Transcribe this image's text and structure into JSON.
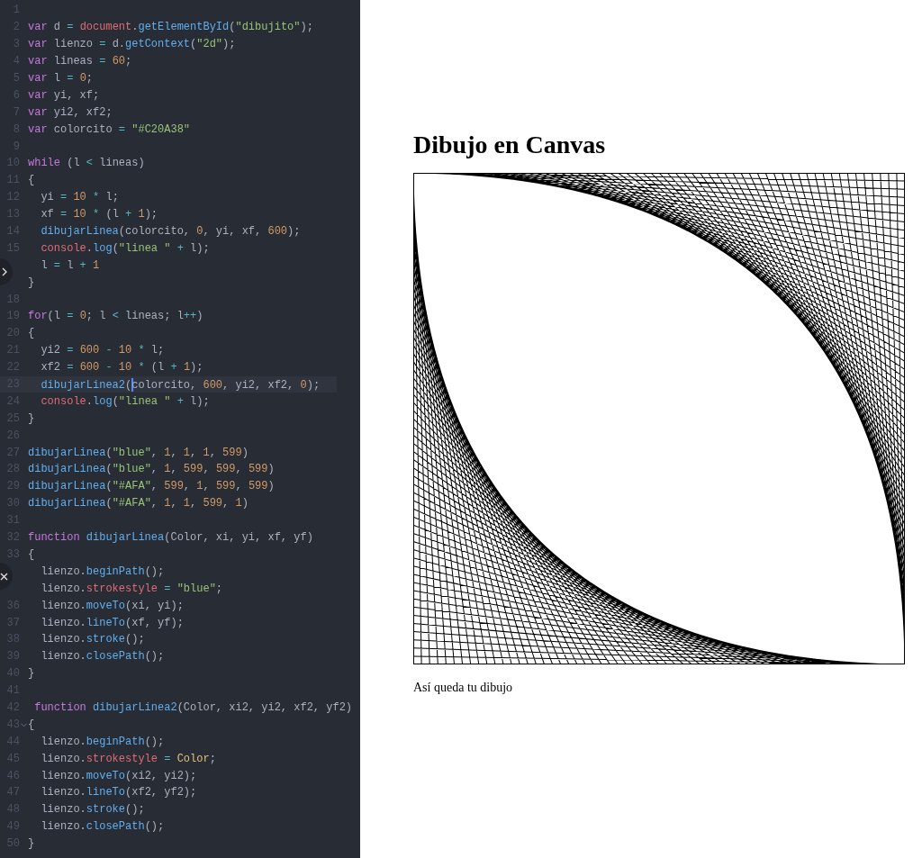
{
  "editor": {
    "lines": [
      {
        "number": "1",
        "active": false,
        "fold_marker": false
      },
      {
        "number": "2",
        "active": false,
        "fold_marker": false,
        "tokens": [
          {
            "kind": "kw",
            "text": "var"
          },
          {
            "kind": "plain",
            "text": " d"
          },
          {
            "kind": "op",
            "text": " = "
          },
          {
            "kind": "red",
            "text": "document"
          },
          {
            "kind": "plain",
            "text": "."
          },
          {
            "kind": "fn",
            "text": "getElementById"
          },
          {
            "kind": "plain",
            "text": "("
          },
          {
            "kind": "str",
            "text": "\"dibujito\""
          },
          {
            "kind": "plain",
            "text": ");"
          }
        ]
      },
      {
        "number": "3",
        "active": false,
        "fold_marker": false,
        "tokens": [
          {
            "kind": "kw",
            "text": "var"
          },
          {
            "kind": "plain",
            "text": " lienzo"
          },
          {
            "kind": "op",
            "text": " = "
          },
          {
            "kind": "plain",
            "text": "d."
          },
          {
            "kind": "fn",
            "text": "getContext"
          },
          {
            "kind": "plain",
            "text": "("
          },
          {
            "kind": "str",
            "text": "\"2d\""
          },
          {
            "kind": "plain",
            "text": ");"
          }
        ]
      },
      {
        "number": "4",
        "active": false,
        "fold_marker": false,
        "tokens": [
          {
            "kind": "kw",
            "text": "var"
          },
          {
            "kind": "plain",
            "text": " lineas"
          },
          {
            "kind": "op",
            "text": " = "
          },
          {
            "kind": "num",
            "text": "60"
          },
          {
            "kind": "plain",
            "text": ";"
          }
        ]
      },
      {
        "number": "5",
        "active": false,
        "fold_marker": false,
        "tokens": [
          {
            "kind": "kw",
            "text": "var"
          },
          {
            "kind": "plain",
            "text": " l"
          },
          {
            "kind": "op",
            "text": " = "
          },
          {
            "kind": "num",
            "text": "0"
          },
          {
            "kind": "plain",
            "text": ";"
          }
        ]
      },
      {
        "number": "6",
        "active": false,
        "fold_marker": false,
        "tokens": [
          {
            "kind": "kw",
            "text": "var"
          },
          {
            "kind": "plain",
            "text": " yi, xf;"
          }
        ]
      },
      {
        "number": "7",
        "active": false,
        "fold_marker": false,
        "tokens": [
          {
            "kind": "kw",
            "text": "var"
          },
          {
            "kind": "plain",
            "text": " yi2, xf2;"
          }
        ]
      },
      {
        "number": "8",
        "active": false,
        "fold_marker": false,
        "tokens": [
          {
            "kind": "kw",
            "text": "var"
          },
          {
            "kind": "plain",
            "text": " colorcito"
          },
          {
            "kind": "op",
            "text": " = "
          },
          {
            "kind": "str",
            "text": "\"#C20A38\""
          }
        ]
      },
      {
        "number": "9",
        "active": false,
        "fold_marker": false
      },
      {
        "number": "10",
        "active": false,
        "fold_marker": false,
        "tokens": [
          {
            "kind": "kw",
            "text": "while"
          },
          {
            "kind": "plain",
            "text": " (l"
          },
          {
            "kind": "op",
            "text": " < "
          },
          {
            "kind": "plain",
            "text": "lineas)"
          }
        ]
      },
      {
        "number": "11",
        "active": false,
        "fold_marker": false,
        "tokens": [
          {
            "kind": "plain",
            "text": "{"
          }
        ]
      },
      {
        "number": "12",
        "active": false,
        "fold_marker": false,
        "tokens": [
          {
            "kind": "plain",
            "text": "  yi"
          },
          {
            "kind": "op",
            "text": " = "
          },
          {
            "kind": "num",
            "text": "10"
          },
          {
            "kind": "op",
            "text": " * "
          },
          {
            "kind": "plain",
            "text": "l;"
          }
        ]
      },
      {
        "number": "13",
        "active": false,
        "fold_marker": false,
        "tokens": [
          {
            "kind": "plain",
            "text": "  xf"
          },
          {
            "kind": "op",
            "text": " = "
          },
          {
            "kind": "num",
            "text": "10"
          },
          {
            "kind": "op",
            "text": " * "
          },
          {
            "kind": "plain",
            "text": "(l"
          },
          {
            "kind": "op",
            "text": " + "
          },
          {
            "kind": "num",
            "text": "1"
          },
          {
            "kind": "plain",
            "text": ");"
          }
        ]
      },
      {
        "number": "14",
        "active": false,
        "fold_marker": false,
        "tokens": [
          {
            "kind": "fn",
            "text": "  dibujarLinea"
          },
          {
            "kind": "plain",
            "text": "(colorcito, "
          },
          {
            "kind": "num",
            "text": "0"
          },
          {
            "kind": "plain",
            "text": ", yi, xf, "
          },
          {
            "kind": "num",
            "text": "600"
          },
          {
            "kind": "plain",
            "text": ");"
          }
        ]
      },
      {
        "number": "15",
        "active": false,
        "fold_marker": false,
        "tokens": [
          {
            "kind": "red",
            "text": "  console"
          },
          {
            "kind": "plain",
            "text": "."
          },
          {
            "kind": "fn",
            "text": "log"
          },
          {
            "kind": "plain",
            "text": "("
          },
          {
            "kind": "str",
            "text": "\"linea \""
          },
          {
            "kind": "op",
            "text": " + "
          },
          {
            "kind": "plain",
            "text": "l);"
          }
        ]
      },
      {
        "active": false,
        "fold_marker": false,
        "tokens": [
          {
            "kind": "plain",
            "text": "  l"
          },
          {
            "kind": "op",
            "text": " = "
          },
          {
            "kind": "plain",
            "text": "l"
          },
          {
            "kind": "op",
            "text": " + "
          },
          {
            "kind": "num",
            "text": "1"
          }
        ]
      },
      {
        "active": false,
        "fold_marker": false,
        "tokens": [
          {
            "kind": "plain",
            "text": "}"
          }
        ]
      },
      {
        "number": "18",
        "active": false,
        "fold_marker": false
      },
      {
        "number": "19",
        "active": false,
        "fold_marker": false,
        "tokens": [
          {
            "kind": "kw",
            "text": "for"
          },
          {
            "kind": "plain",
            "text": "(l"
          },
          {
            "kind": "op",
            "text": " = "
          },
          {
            "kind": "num",
            "text": "0"
          },
          {
            "kind": "plain",
            "text": "; l"
          },
          {
            "kind": "op",
            "text": " < "
          },
          {
            "kind": "plain",
            "text": "lineas; l"
          },
          {
            "kind": "op",
            "text": "++"
          },
          {
            "kind": "plain",
            "text": ")"
          }
        ]
      },
      {
        "number": "20",
        "active": false,
        "fold_marker": false,
        "tokens": [
          {
            "kind": "plain",
            "text": "{"
          }
        ]
      },
      {
        "number": "21",
        "active": false,
        "fold_marker": false,
        "tokens": [
          {
            "kind": "plain",
            "text": "  yi2"
          },
          {
            "kind": "op",
            "text": " = "
          },
          {
            "kind": "num",
            "text": "600"
          },
          {
            "kind": "op",
            "text": " - "
          },
          {
            "kind": "num",
            "text": "10"
          },
          {
            "kind": "op",
            "text": " * "
          },
          {
            "kind": "plain",
            "text": "l;"
          }
        ]
      },
      {
        "number": "22",
        "active": false,
        "fold_marker": false,
        "tokens": [
          {
            "kind": "plain",
            "text": "  xf2"
          },
          {
            "kind": "op",
            "text": " = "
          },
          {
            "kind": "num",
            "text": "600"
          },
          {
            "kind": "op",
            "text": " - "
          },
          {
            "kind": "num",
            "text": "10"
          },
          {
            "kind": "op",
            "text": " * "
          },
          {
            "kind": "plain",
            "text": "(l"
          },
          {
            "kind": "op",
            "text": " + "
          },
          {
            "kind": "num",
            "text": "1"
          },
          {
            "kind": "plain",
            "text": ");"
          }
        ]
      },
      {
        "number": "23",
        "active": true,
        "fold_marker": false,
        "tokens": [
          {
            "kind": "fn",
            "text": "  dibujarLinea2"
          },
          {
            "kind": "plain",
            "text": "("
          },
          {
            "kind": "cursor"
          },
          {
            "kind": "plain",
            "text": "colorcito, "
          },
          {
            "kind": "num",
            "text": "600"
          },
          {
            "kind": "plain",
            "text": ", yi2, xf2, "
          },
          {
            "kind": "num",
            "text": "0"
          },
          {
            "kind": "plain",
            "text": ");"
          }
        ]
      },
      {
        "number": "24",
        "active": false,
        "fold_marker": false,
        "tokens": [
          {
            "kind": "red",
            "text": "  console"
          },
          {
            "kind": "plain",
            "text": "."
          },
          {
            "kind": "fn",
            "text": "log"
          },
          {
            "kind": "plain",
            "text": "("
          },
          {
            "kind": "str",
            "text": "\"linea \""
          },
          {
            "kind": "op",
            "text": " + "
          },
          {
            "kind": "plain",
            "text": "l);"
          }
        ]
      },
      {
        "number": "25",
        "active": false,
        "fold_marker": false,
        "tokens": [
          {
            "kind": "plain",
            "text": "}"
          }
        ]
      },
      {
        "number": "26",
        "active": false,
        "fold_marker": false
      },
      {
        "number": "27",
        "active": false,
        "fold_marker": false,
        "tokens": [
          {
            "kind": "fn",
            "text": "dibujarLinea"
          },
          {
            "kind": "plain",
            "text": "("
          },
          {
            "kind": "str",
            "text": "\"blue\""
          },
          {
            "kind": "plain",
            "text": ", "
          },
          {
            "kind": "num",
            "text": "1"
          },
          {
            "kind": "plain",
            "text": ", "
          },
          {
            "kind": "num",
            "text": "1"
          },
          {
            "kind": "plain",
            "text": ", "
          },
          {
            "kind": "num",
            "text": "1"
          },
          {
            "kind": "plain",
            "text": ", "
          },
          {
            "kind": "num",
            "text": "599"
          },
          {
            "kind": "plain",
            "text": ")"
          }
        ]
      },
      {
        "number": "28",
        "active": false,
        "fold_marker": false,
        "tokens": [
          {
            "kind": "fn",
            "text": "dibujarLinea"
          },
          {
            "kind": "plain",
            "text": "("
          },
          {
            "kind": "str",
            "text": "\"blue\""
          },
          {
            "kind": "plain",
            "text": ", "
          },
          {
            "kind": "num",
            "text": "1"
          },
          {
            "kind": "plain",
            "text": ", "
          },
          {
            "kind": "num",
            "text": "599"
          },
          {
            "kind": "plain",
            "text": ", "
          },
          {
            "kind": "num",
            "text": "599"
          },
          {
            "kind": "plain",
            "text": ", "
          },
          {
            "kind": "num",
            "text": "599"
          },
          {
            "kind": "plain",
            "text": ")"
          }
        ]
      },
      {
        "number": "29",
        "active": false,
        "fold_marker": false,
        "tokens": [
          {
            "kind": "fn",
            "text": "dibujarLinea"
          },
          {
            "kind": "plain",
            "text": "("
          },
          {
            "kind": "str",
            "text": "\"#AFA\""
          },
          {
            "kind": "plain",
            "text": ", "
          },
          {
            "kind": "num",
            "text": "599"
          },
          {
            "kind": "plain",
            "text": ", "
          },
          {
            "kind": "num",
            "text": "1"
          },
          {
            "kind": "plain",
            "text": ", "
          },
          {
            "kind": "num",
            "text": "599"
          },
          {
            "kind": "plain",
            "text": ", "
          },
          {
            "kind": "num",
            "text": "599"
          },
          {
            "kind": "plain",
            "text": ")"
          }
        ]
      },
      {
        "number": "30",
        "active": false,
        "fold_marker": false,
        "tokens": [
          {
            "kind": "fn",
            "text": "dibujarLinea"
          },
          {
            "kind": "plain",
            "text": "("
          },
          {
            "kind": "str",
            "text": "\"#AFA\""
          },
          {
            "kind": "plain",
            "text": ", "
          },
          {
            "kind": "num",
            "text": "1"
          },
          {
            "kind": "plain",
            "text": ", "
          },
          {
            "kind": "num",
            "text": "1"
          },
          {
            "kind": "plain",
            "text": ", "
          },
          {
            "kind": "num",
            "text": "599"
          },
          {
            "kind": "plain",
            "text": ", "
          },
          {
            "kind": "num",
            "text": "1"
          },
          {
            "kind": "plain",
            "text": ")"
          }
        ]
      },
      {
        "number": "31",
        "active": false,
        "fold_marker": false
      },
      {
        "number": "32",
        "active": false,
        "fold_marker": false,
        "tokens": [
          {
            "kind": "kw",
            "text": "function"
          },
          {
            "kind": "fn",
            "text": " dibujarLinea"
          },
          {
            "kind": "plain",
            "text": "(Color, xi, yi, xf, yf)"
          }
        ]
      },
      {
        "number": "33",
        "active": false,
        "fold_marker": false,
        "tokens": [
          {
            "kind": "plain",
            "text": "{"
          }
        ]
      },
      {
        "active": false,
        "fold_marker": false,
        "tokens": [
          {
            "kind": "plain",
            "text": "  lienzo."
          },
          {
            "kind": "fn",
            "text": "beginPath"
          },
          {
            "kind": "plain",
            "text": "();"
          }
        ]
      },
      {
        "active": false,
        "fold_marker": false,
        "tokens": [
          {
            "kind": "plain",
            "text": "  lienzo."
          },
          {
            "kind": "red",
            "text": "strokestyle"
          },
          {
            "kind": "op",
            "text": " = "
          },
          {
            "kind": "str",
            "text": "\"blue\""
          },
          {
            "kind": "plain",
            "text": ";"
          }
        ]
      },
      {
        "number": "36",
        "active": false,
        "fold_marker": false,
        "tokens": [
          {
            "kind": "plain",
            "text": "  lienzo."
          },
          {
            "kind": "fn",
            "text": "moveTo"
          },
          {
            "kind": "plain",
            "text": "(xi, yi);"
          }
        ]
      },
      {
        "number": "37",
        "active": false,
        "fold_marker": false,
        "tokens": [
          {
            "kind": "plain",
            "text": "  lienzo."
          },
          {
            "kind": "fn",
            "text": "lineTo"
          },
          {
            "kind": "plain",
            "text": "(xf, yf);"
          }
        ]
      },
      {
        "number": "38",
        "active": false,
        "fold_marker": false,
        "tokens": [
          {
            "kind": "plain",
            "text": "  lienzo."
          },
          {
            "kind": "fn",
            "text": "stroke"
          },
          {
            "kind": "plain",
            "text": "();"
          }
        ]
      },
      {
        "number": "39",
        "active": false,
        "fold_marker": false,
        "tokens": [
          {
            "kind": "plain",
            "text": "  lienzo."
          },
          {
            "kind": "fn",
            "text": "closePath"
          },
          {
            "kind": "plain",
            "text": "();"
          }
        ]
      },
      {
        "number": "40",
        "active": false,
        "fold_marker": false,
        "tokens": [
          {
            "kind": "plain",
            "text": "}"
          }
        ]
      },
      {
        "number": "41",
        "active": false,
        "fold_marker": false
      },
      {
        "number": "42",
        "active": false,
        "fold_marker": false,
        "tokens": [
          {
            "kind": "kw",
            "text": " function"
          },
          {
            "kind": "fn",
            "text": " dibujarLinea2"
          },
          {
            "kind": "plain",
            "text": "(Color, xi2, yi2, xf2, yf2)"
          }
        ]
      },
      {
        "number": "43",
        "active": false,
        "fold_marker": true,
        "tokens": [
          {
            "kind": "plain",
            "text": "{"
          }
        ]
      },
      {
        "number": "44",
        "active": false,
        "fold_marker": false,
        "tokens": [
          {
            "kind": "plain",
            "text": "  lienzo."
          },
          {
            "kind": "fn",
            "text": "beginPath"
          },
          {
            "kind": "plain",
            "text": "();"
          }
        ]
      },
      {
        "number": "45",
        "active": false,
        "fold_marker": false,
        "tokens": [
          {
            "kind": "plain",
            "text": "  lienzo."
          },
          {
            "kind": "red",
            "text": "strokestyle"
          },
          {
            "kind": "op",
            "text": " = "
          },
          {
            "kind": "param",
            "text": "Color"
          },
          {
            "kind": "plain",
            "text": ";"
          }
        ]
      },
      {
        "number": "46",
        "active": false,
        "fold_marker": false,
        "tokens": [
          {
            "kind": "plain",
            "text": "  lienzo."
          },
          {
            "kind": "fn",
            "text": "moveTo"
          },
          {
            "kind": "plain",
            "text": "(xi2, yi2);"
          }
        ]
      },
      {
        "number": "47",
        "active": false,
        "fold_marker": false,
        "tokens": [
          {
            "kind": "plain",
            "text": "  lienzo."
          },
          {
            "kind": "fn",
            "text": "lineTo"
          },
          {
            "kind": "plain",
            "text": "(xf2, yf2);"
          }
        ]
      },
      {
        "number": "48",
        "active": false,
        "fold_marker": false,
        "tokens": [
          {
            "kind": "plain",
            "text": "  lienzo."
          },
          {
            "kind": "fn",
            "text": "stroke"
          },
          {
            "kind": "plain",
            "text": "();"
          }
        ]
      },
      {
        "number": "49",
        "active": false,
        "fold_marker": false,
        "tokens": [
          {
            "kind": "plain",
            "text": "  lienzo."
          },
          {
            "kind": "fn",
            "text": "closePath"
          },
          {
            "kind": "plain",
            "text": "();"
          }
        ]
      },
      {
        "number": "50",
        "active": false,
        "fold_marker": false,
        "tokens": [
          {
            "kind": "plain",
            "text": "}"
          }
        ]
      }
    ]
  },
  "preview": {
    "title": "Dibujo en Canvas",
    "caption": "Así queda tu dibujo"
  }
}
